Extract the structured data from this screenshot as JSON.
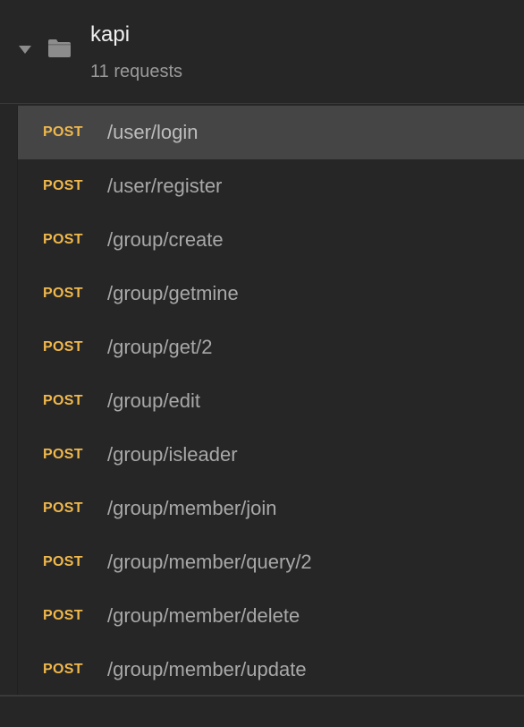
{
  "collection": {
    "name": "kapi",
    "count_label": "11 requests",
    "caret_icon": "caret-down-icon",
    "folder_icon": "folder-icon"
  },
  "colors": {
    "method_post": "#f0b84c",
    "selected_row": "#454545",
    "background": "#262626"
  },
  "requests": [
    {
      "method": "POST",
      "path": "/user/login",
      "selected": true
    },
    {
      "method": "POST",
      "path": "/user/register",
      "selected": false
    },
    {
      "method": "POST",
      "path": "/group/create",
      "selected": false
    },
    {
      "method": "POST",
      "path": "/group/getmine",
      "selected": false
    },
    {
      "method": "POST",
      "path": "/group/get/2",
      "selected": false
    },
    {
      "method": "POST",
      "path": "/group/edit",
      "selected": false
    },
    {
      "method": "POST",
      "path": "/group/isleader",
      "selected": false
    },
    {
      "method": "POST",
      "path": "/group/member/join",
      "selected": false
    },
    {
      "method": "POST",
      "path": "/group/member/query/2",
      "selected": false
    },
    {
      "method": "POST",
      "path": "/group/member/delete",
      "selected": false
    },
    {
      "method": "POST",
      "path": "/group/member/update",
      "selected": false
    }
  ]
}
